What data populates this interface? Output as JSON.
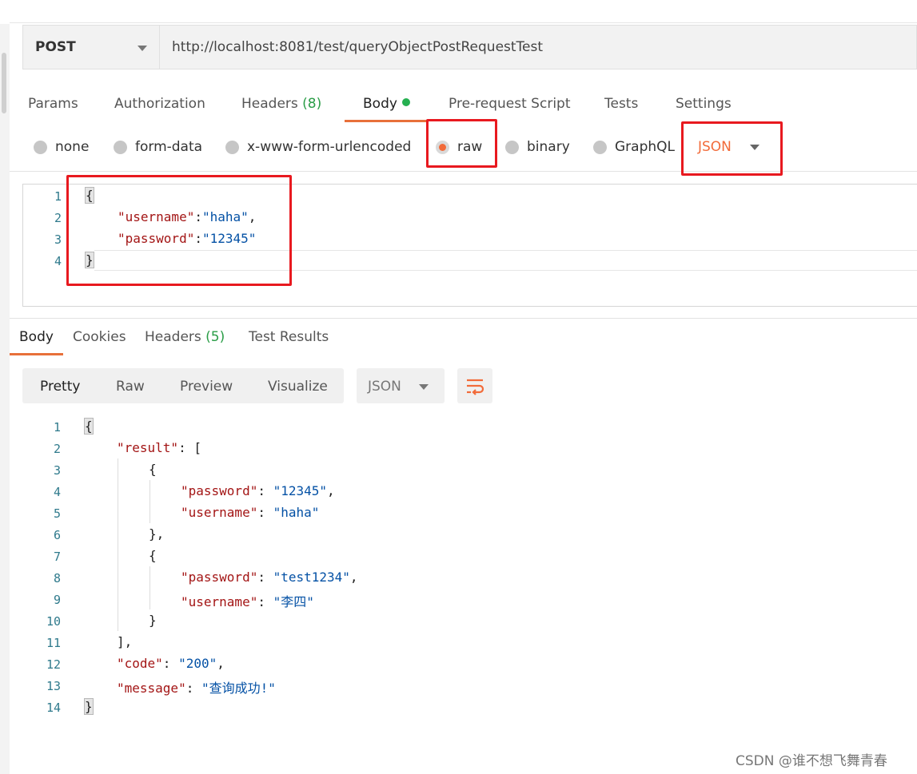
{
  "request": {
    "method": "POST",
    "url": "http://localhost:8081/test/queryObjectPostRequestTest",
    "tabs": [
      {
        "label": "Params"
      },
      {
        "label": "Authorization"
      },
      {
        "label": "Headers",
        "count": "(8)"
      },
      {
        "label": "Body"
      },
      {
        "label": "Pre-request Script"
      },
      {
        "label": "Tests"
      },
      {
        "label": "Settings"
      }
    ],
    "active_tab": "Body",
    "body_types": [
      "none",
      "form-data",
      "x-www-form-urlencoded",
      "raw",
      "binary",
      "GraphQL"
    ],
    "selected_body_type": "raw",
    "language": "JSON",
    "body_lines": [
      "1",
      "2",
      "3",
      "4"
    ],
    "body": {
      "open": "{",
      "key1": "\"username\"",
      "val1": "\"haha\"",
      "key2": "\"password\"",
      "val2": "\"12345\"",
      "close": "}"
    }
  },
  "response": {
    "tabs": [
      {
        "label": "Body"
      },
      {
        "label": "Cookies"
      },
      {
        "label": "Headers",
        "count": "(5)"
      },
      {
        "label": "Test Results"
      }
    ],
    "active_tab": "Body",
    "view_modes": [
      "Pretty",
      "Raw",
      "Preview",
      "Visualize"
    ],
    "active_view": "Pretty",
    "format": "JSON",
    "line_numbers": [
      "1",
      "2",
      "3",
      "4",
      "5",
      "6",
      "7",
      "8",
      "9",
      "10",
      "11",
      "12",
      "13",
      "14"
    ],
    "json": {
      "result_key": "\"result\"",
      "pw_key": "\"password\"",
      "un_key": "\"username\"",
      "r1_pw": "\"12345\"",
      "r1_un": "\"haha\"",
      "r2_pw": "\"test1234\"",
      "r2_un": "\"李四\"",
      "code_key": "\"code\"",
      "code_val": "\"200\"",
      "message_key": "\"message\"",
      "message_val": "\"查询成功!\""
    }
  },
  "colors": {
    "accent": "#f26b3a",
    "highlight_box": "#e8191f",
    "json_key": "#a31515",
    "json_string": "#0451a5",
    "count_green": "#2a9d47"
  },
  "watermark": "CSDN @谁不想飞舞青春"
}
